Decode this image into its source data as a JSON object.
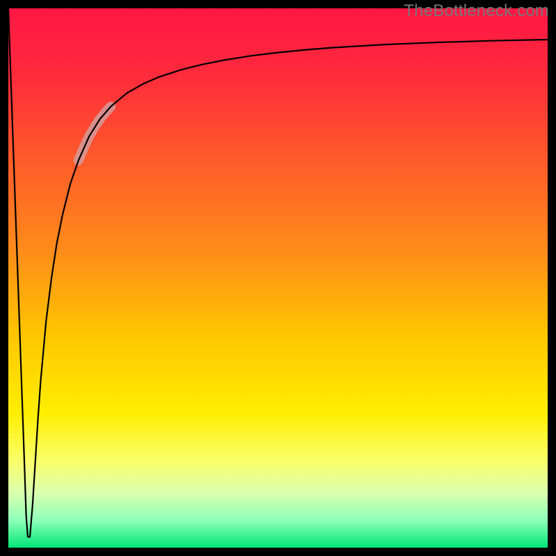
{
  "watermark": "TheBottleneck.com",
  "chart_data": {
    "type": "line",
    "title": "",
    "xlabel": "",
    "ylabel": "",
    "xlim": [
      0,
      100
    ],
    "ylim": [
      0,
      100
    ],
    "grid": false,
    "legend": false,
    "background_gradient_stops": [
      {
        "offset": 0.0,
        "color": "#ff1744"
      },
      {
        "offset": 0.12,
        "color": "#ff2a3c"
      },
      {
        "offset": 0.28,
        "color": "#ff5a2a"
      },
      {
        "offset": 0.45,
        "color": "#ff8c1a"
      },
      {
        "offset": 0.6,
        "color": "#ffc400"
      },
      {
        "offset": 0.75,
        "color": "#ffee00"
      },
      {
        "offset": 0.84,
        "color": "#faff6b"
      },
      {
        "offset": 0.9,
        "color": "#d8ffb0"
      },
      {
        "offset": 0.95,
        "color": "#8dffb8"
      },
      {
        "offset": 1.0,
        "color": "#00e676"
      }
    ],
    "series": [
      {
        "name": "bottleneck-curve",
        "color": "#000000",
        "stroke_width": 2.2,
        "x": [
          0.0,
          0.6,
          1.2,
          1.8,
          2.4,
          3.0,
          3.3,
          3.6,
          4.0,
          4.5,
          5.0,
          5.5,
          6.0,
          7.0,
          8.0,
          9.0,
          10.0,
          11.5,
          13.0,
          15.0,
          17.0,
          19.0,
          22.0,
          25.0,
          28.0,
          32.0,
          36.0,
          40.0,
          45.0,
          50.0,
          55.0,
          60.0,
          65.0,
          70.0,
          75.0,
          80.0,
          85.0,
          90.0,
          95.0,
          100.0
        ],
        "y": [
          100.0,
          83.0,
          66.0,
          49.0,
          32.0,
          15.0,
          6.0,
          2.0,
          2.0,
          8.0,
          16.0,
          24.0,
          31.0,
          42.0,
          50.0,
          56.5,
          61.5,
          67.5,
          71.8,
          76.3,
          79.5,
          81.8,
          84.3,
          86.0,
          87.3,
          88.6,
          89.6,
          90.4,
          91.2,
          91.8,
          92.3,
          92.7,
          93.0,
          93.3,
          93.5,
          93.7,
          93.85,
          94.0,
          94.1,
          94.2
        ]
      }
    ],
    "highlight_segment": {
      "color": "#d59a9a",
      "opacity": 0.85,
      "stroke_width": 14,
      "x": [
        13.0,
        14.0,
        15.0,
        16.0,
        17.0,
        18.0,
        19.0
      ],
      "y": [
        71.8,
        74.2,
        76.3,
        78.0,
        79.5,
        80.7,
        81.8
      ]
    },
    "frame": {
      "color": "#000000",
      "stroke_width": 12
    }
  }
}
